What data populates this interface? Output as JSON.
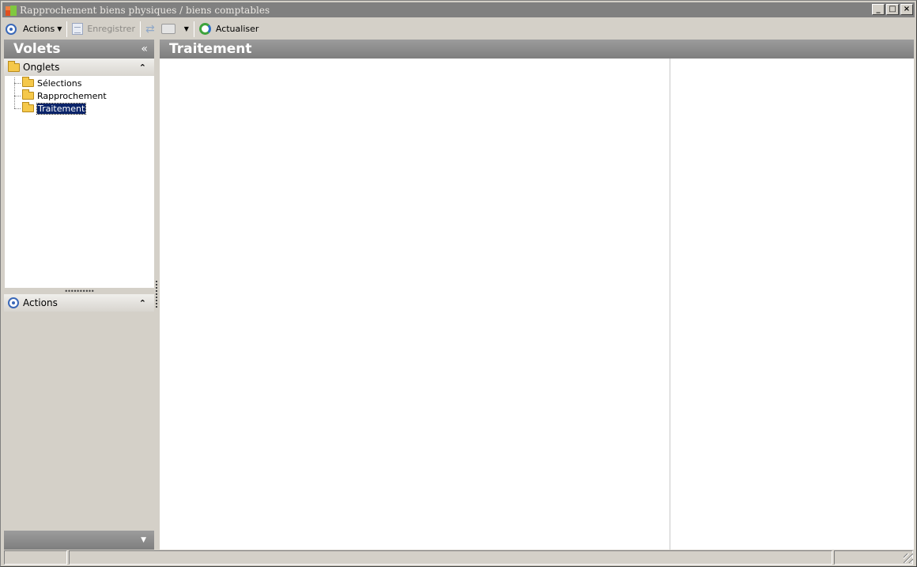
{
  "window": {
    "title": "Rapprochement biens physiques / biens comptables",
    "controls": {
      "minimize": "_",
      "maximize": "□",
      "close": "×"
    }
  },
  "toolbar": {
    "actions_label": "Actions",
    "save_label": "Enregistrer",
    "refresh_label": "Actualiser"
  },
  "left_panel": {
    "title": "Volets",
    "collapse_glyph": "«",
    "tabs_group": {
      "label": "Onglets",
      "items": [
        {
          "label": "Sélections",
          "selected": false
        },
        {
          "label": "Rapprochement",
          "selected": false
        },
        {
          "label": "Traitement",
          "selected": true
        }
      ]
    },
    "actions_group": {
      "label": "Actions"
    }
  },
  "main_panel": {
    "title": "Traitement"
  },
  "statusbar": {
    "cells": [
      "",
      "",
      ""
    ]
  },
  "colors": {
    "header_gray": "#8a8a8a",
    "selection_blue": "#0a246a",
    "window_bg": "#d4d0c8"
  }
}
